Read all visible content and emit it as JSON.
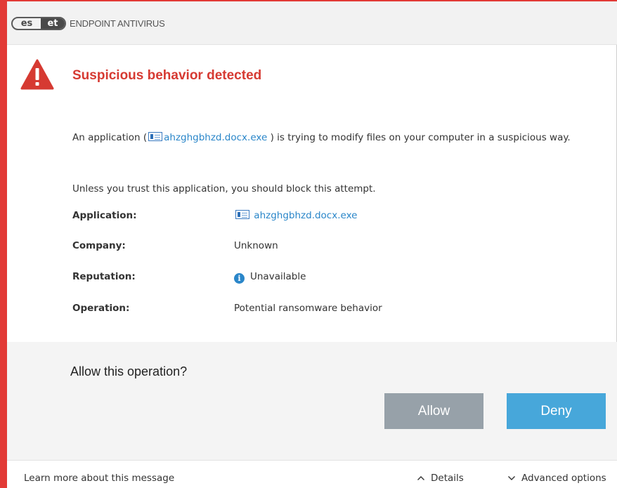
{
  "window": {
    "brand_left": "es",
    "brand_right": "et",
    "product_name": "ENDPOINT ANTIVIRUS"
  },
  "alert": {
    "title": "Suspicious behavior detected",
    "message_prefix": "An application (",
    "message_app": "ahzghgbhzd.docx.exe",
    "message_suffix": " ) is trying to modify files on your computer in a suspicious way.",
    "advice": "Unless you trust this application, you should block this attempt."
  },
  "details": {
    "application_label": "Application:",
    "application_value": "ahzghgbhzd.docx.exe",
    "company_label": "Company:",
    "company_value": "Unknown",
    "reputation_label": "Reputation:",
    "reputation_value": "Unavailable",
    "operation_label": "Operation:",
    "operation_value": "Potential ransomware behavior"
  },
  "prompt": {
    "question": "Allow this operation?",
    "allow_label": "Allow",
    "deny_label": "Deny"
  },
  "footer": {
    "learn_more": "Learn more about this message",
    "details_label": "Details",
    "advanced_label": "Advanced options"
  },
  "colors": {
    "accent_red": "#e23a36",
    "title_red": "#d63a32",
    "link_blue": "#2a86c9",
    "allow_gray": "#97a1a9",
    "deny_blue": "#47a7da"
  }
}
